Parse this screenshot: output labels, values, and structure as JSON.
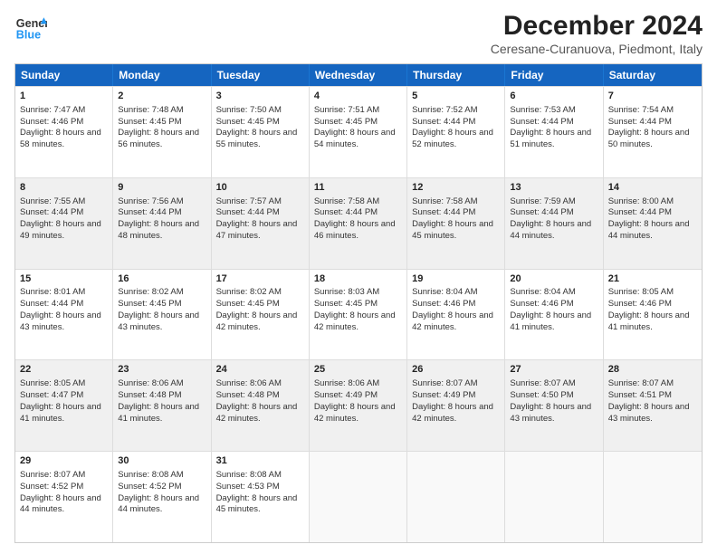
{
  "header": {
    "logo_line1": "General",
    "logo_line2": "Blue",
    "title": "December 2024",
    "subtitle": "Ceresane-Curanuova, Piedmont, Italy"
  },
  "calendar": {
    "weekdays": [
      "Sunday",
      "Monday",
      "Tuesday",
      "Wednesday",
      "Thursday",
      "Friday",
      "Saturday"
    ],
    "weeks": [
      [
        {
          "day": "",
          "empty": true
        },
        {
          "day": "",
          "empty": true
        },
        {
          "day": "",
          "empty": true
        },
        {
          "day": "",
          "empty": true
        },
        {
          "day": "",
          "empty": true
        },
        {
          "day": "",
          "empty": true
        },
        {
          "day": "",
          "empty": true
        }
      ]
    ]
  },
  "days": [
    {
      "num": "1",
      "rise": "7:47 AM",
      "set": "4:46 PM",
      "daylight": "8 hours and 58 minutes."
    },
    {
      "num": "2",
      "rise": "7:48 AM",
      "set": "4:45 PM",
      "daylight": "8 hours and 56 minutes."
    },
    {
      "num": "3",
      "rise": "7:50 AM",
      "set": "4:45 PM",
      "daylight": "8 hours and 55 minutes."
    },
    {
      "num": "4",
      "rise": "7:51 AM",
      "set": "4:45 PM",
      "daylight": "8 hours and 54 minutes."
    },
    {
      "num": "5",
      "rise": "7:52 AM",
      "set": "4:44 PM",
      "daylight": "8 hours and 52 minutes."
    },
    {
      "num": "6",
      "rise": "7:53 AM",
      "set": "4:44 PM",
      "daylight": "8 hours and 51 minutes."
    },
    {
      "num": "7",
      "rise": "7:54 AM",
      "set": "4:44 PM",
      "daylight": "8 hours and 50 minutes."
    },
    {
      "num": "8",
      "rise": "7:55 AM",
      "set": "4:44 PM",
      "daylight": "8 hours and 49 minutes."
    },
    {
      "num": "9",
      "rise": "7:56 AM",
      "set": "4:44 PM",
      "daylight": "8 hours and 48 minutes."
    },
    {
      "num": "10",
      "rise": "7:57 AM",
      "set": "4:44 PM",
      "daylight": "8 hours and 47 minutes."
    },
    {
      "num": "11",
      "rise": "7:58 AM",
      "set": "4:44 PM",
      "daylight": "8 hours and 46 minutes."
    },
    {
      "num": "12",
      "rise": "7:58 AM",
      "set": "4:44 PM",
      "daylight": "8 hours and 45 minutes."
    },
    {
      "num": "13",
      "rise": "7:59 AM",
      "set": "4:44 PM",
      "daylight": "8 hours and 44 minutes."
    },
    {
      "num": "14",
      "rise": "8:00 AM",
      "set": "4:44 PM",
      "daylight": "8 hours and 44 minutes."
    },
    {
      "num": "15",
      "rise": "8:01 AM",
      "set": "4:44 PM",
      "daylight": "8 hours and 43 minutes."
    },
    {
      "num": "16",
      "rise": "8:02 AM",
      "set": "4:45 PM",
      "daylight": "8 hours and 43 minutes."
    },
    {
      "num": "17",
      "rise": "8:02 AM",
      "set": "4:45 PM",
      "daylight": "8 hours and 42 minutes."
    },
    {
      "num": "18",
      "rise": "8:03 AM",
      "set": "4:45 PM",
      "daylight": "8 hours and 42 minutes."
    },
    {
      "num": "19",
      "rise": "8:04 AM",
      "set": "4:46 PM",
      "daylight": "8 hours and 42 minutes."
    },
    {
      "num": "20",
      "rise": "8:04 AM",
      "set": "4:46 PM",
      "daylight": "8 hours and 41 minutes."
    },
    {
      "num": "21",
      "rise": "8:05 AM",
      "set": "4:46 PM",
      "daylight": "8 hours and 41 minutes."
    },
    {
      "num": "22",
      "rise": "8:05 AM",
      "set": "4:47 PM",
      "daylight": "8 hours and 41 minutes."
    },
    {
      "num": "23",
      "rise": "8:06 AM",
      "set": "4:48 PM",
      "daylight": "8 hours and 41 minutes."
    },
    {
      "num": "24",
      "rise": "8:06 AM",
      "set": "4:48 PM",
      "daylight": "8 hours and 42 minutes."
    },
    {
      "num": "25",
      "rise": "8:06 AM",
      "set": "4:49 PM",
      "daylight": "8 hours and 42 minutes."
    },
    {
      "num": "26",
      "rise": "8:07 AM",
      "set": "4:49 PM",
      "daylight": "8 hours and 42 minutes."
    },
    {
      "num": "27",
      "rise": "8:07 AM",
      "set": "4:50 PM",
      "daylight": "8 hours and 43 minutes."
    },
    {
      "num": "28",
      "rise": "8:07 AM",
      "set": "4:51 PM",
      "daylight": "8 hours and 43 minutes."
    },
    {
      "num": "29",
      "rise": "8:07 AM",
      "set": "4:52 PM",
      "daylight": "8 hours and 44 minutes."
    },
    {
      "num": "30",
      "rise": "8:08 AM",
      "set": "4:52 PM",
      "daylight": "8 hours and 44 minutes."
    },
    {
      "num": "31",
      "rise": "8:08 AM",
      "set": "4:53 PM",
      "daylight": "8 hours and 45 minutes."
    }
  ],
  "labels": {
    "sunrise": "Sunrise:",
    "sunset": "Sunset:",
    "daylight": "Daylight:"
  }
}
